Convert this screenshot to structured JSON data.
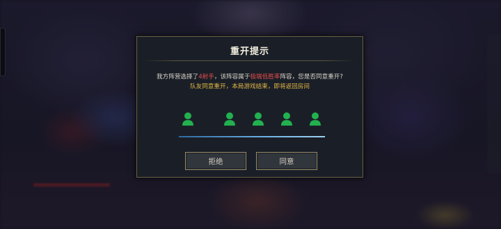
{
  "dialog": {
    "title": "重开提示",
    "message_part1": "我方阵营选择了",
    "message_highlight1": "4射手",
    "message_part2": "，该阵容属于",
    "message_highlight2": "极端低胜率",
    "message_part3": "阵容，您是否同意重开?",
    "notice": "队友同意重开，本局游戏结束，即将返回房间",
    "players": [
      {
        "status": "agreed",
        "color": "#23b04f"
      },
      {
        "status": "agreed",
        "color": "#23b04f"
      },
      {
        "status": "agreed",
        "color": "#23b04f"
      },
      {
        "status": "agreed",
        "color": "#23b04f"
      },
      {
        "status": "agreed",
        "color": "#23b04f"
      }
    ],
    "reject_label": "拒绝",
    "agree_label": "同意"
  },
  "colors": {
    "highlight": "#e24b4b",
    "notice": "#e0b545",
    "player_agreed": "#23b04f",
    "border": "#9a8d69"
  }
}
